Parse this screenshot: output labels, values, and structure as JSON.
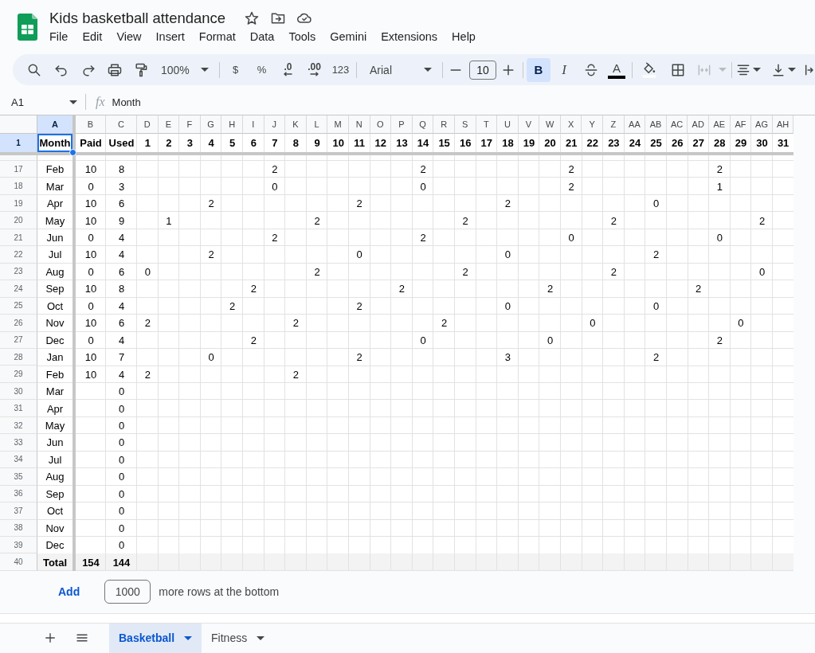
{
  "document": {
    "title": "Kids basketball attendance"
  },
  "menu": [
    "File",
    "Edit",
    "View",
    "Insert",
    "Format",
    "Data",
    "Tools",
    "Gemini",
    "Extensions",
    "Help"
  ],
  "toolbar": {
    "groups": [
      {
        "items": [
          {
            "kind": "search"
          },
          {
            "kind": "undo"
          },
          {
            "kind": "redo"
          },
          {
            "kind": "print"
          },
          {
            "kind": "paint-format"
          },
          {
            "kind": "zoom",
            "label": "100%"
          }
        ]
      },
      {
        "items": [
          {
            "kind": "text",
            "label": "$"
          },
          {
            "kind": "text",
            "label": "%"
          },
          {
            "kind": "decrease-decimal",
            "label": ".0"
          },
          {
            "kind": "increase-decimal",
            "label": ".00"
          },
          {
            "kind": "text",
            "label": "123"
          }
        ]
      },
      {
        "items": [
          {
            "kind": "font",
            "label": "Arial"
          }
        ]
      },
      {
        "items": [
          {
            "kind": "minus"
          },
          {
            "kind": "font-size",
            "value": "10"
          },
          {
            "kind": "plus"
          }
        ]
      },
      {
        "items": [
          {
            "kind": "bold",
            "label": "B",
            "on": true
          },
          {
            "kind": "italic",
            "label": "I",
            "on": false
          },
          {
            "kind": "strikethrough",
            "on": false
          },
          {
            "kind": "text-color",
            "label": "A",
            "on": false
          }
        ]
      },
      {
        "items": [
          {
            "kind": "fill-color",
            "disabled": false
          },
          {
            "kind": "borders",
            "disabled": false
          },
          {
            "kind": "merge",
            "disabled": true
          }
        ]
      },
      {
        "items": [
          {
            "kind": "align"
          },
          {
            "kind": "vertical-align"
          },
          {
            "kind": "wrap"
          }
        ]
      }
    ]
  },
  "formula_bar": {
    "name_box": "A1",
    "function_label": "fx",
    "content": "Month"
  },
  "grid": {
    "columns": [
      {
        "label": "A",
        "selected": true
      },
      {
        "label": "B",
        "selected": false
      },
      {
        "label": "C",
        "selected": false
      },
      {
        "label": "D",
        "selected": false
      },
      {
        "label": "E",
        "selected": false
      },
      {
        "label": "F",
        "selected": false
      },
      {
        "label": "G",
        "selected": false
      },
      {
        "label": "H",
        "selected": false
      },
      {
        "label": "I",
        "selected": false
      },
      {
        "label": "J",
        "selected": false
      },
      {
        "label": "K",
        "selected": false
      },
      {
        "label": "L",
        "selected": false
      },
      {
        "label": "M",
        "selected": false
      },
      {
        "label": "N",
        "selected": false
      },
      {
        "label": "O",
        "selected": false
      },
      {
        "label": "P",
        "selected": false
      },
      {
        "label": "Q",
        "selected": false
      },
      {
        "label": "R",
        "selected": false
      },
      {
        "label": "S",
        "selected": false
      },
      {
        "label": "T",
        "selected": false
      },
      {
        "label": "U",
        "selected": false
      },
      {
        "label": "V",
        "selected": false
      },
      {
        "label": "W",
        "selected": false
      },
      {
        "label": "X",
        "selected": false
      },
      {
        "label": "Y",
        "selected": false
      },
      {
        "label": "Z",
        "selected": false
      },
      {
        "label": "AA",
        "selected": false
      },
      {
        "label": "AB",
        "selected": false
      },
      {
        "label": "AC",
        "selected": false
      },
      {
        "label": "AD",
        "selected": false
      },
      {
        "label": "AE",
        "selected": false
      },
      {
        "label": "AF",
        "selected": false
      },
      {
        "label": "AG",
        "selected": false
      },
      {
        "label": "AH",
        "selected": false
      }
    ],
    "rows": [
      {
        "number": "1",
        "kind": "header",
        "selected": true,
        "cells": [
          "Month",
          "Paid",
          "Used",
          "1",
          "2",
          "3",
          "4",
          "5",
          "6",
          "7",
          "8",
          "9",
          "10",
          "11",
          "12",
          "13",
          "14",
          "15",
          "16",
          "17",
          "18",
          "19",
          "20",
          "21",
          "22",
          "23",
          "24",
          "25",
          "26",
          "27",
          "28",
          "29",
          "30",
          "31"
        ]
      },
      {
        "number": "17",
        "kind": "data",
        "selected": false,
        "cells": [
          "Feb",
          "10",
          "8",
          null,
          null,
          null,
          null,
          null,
          null,
          "2",
          null,
          null,
          null,
          null,
          null,
          null,
          "2",
          null,
          null,
          null,
          null,
          null,
          null,
          "2",
          null,
          null,
          null,
          null,
          null,
          null,
          "2"
        ]
      },
      {
        "number": "18",
        "kind": "data",
        "selected": false,
        "cells": [
          "Mar",
          "0",
          "3",
          null,
          null,
          null,
          null,
          null,
          null,
          "0",
          null,
          null,
          null,
          null,
          null,
          null,
          "0",
          null,
          null,
          null,
          null,
          null,
          null,
          "2",
          null,
          null,
          null,
          null,
          null,
          null,
          "1"
        ]
      },
      {
        "number": "19",
        "kind": "data",
        "selected": false,
        "cells": [
          "Apr",
          "10",
          "6",
          null,
          null,
          null,
          "2",
          null,
          null,
          null,
          null,
          null,
          null,
          "2",
          null,
          null,
          null,
          null,
          null,
          null,
          "2",
          null,
          null,
          null,
          null,
          null,
          null,
          "0"
        ]
      },
      {
        "number": "20",
        "kind": "data",
        "selected": false,
        "cells": [
          "May",
          "10",
          "9",
          null,
          "1",
          null,
          null,
          null,
          null,
          null,
          null,
          "2",
          null,
          null,
          null,
          null,
          null,
          null,
          "2",
          null,
          null,
          null,
          null,
          null,
          null,
          "2",
          null,
          null,
          null,
          null,
          null,
          null,
          "2"
        ]
      },
      {
        "number": "21",
        "kind": "data",
        "selected": false,
        "cells": [
          "Jun",
          "0",
          "4",
          null,
          null,
          null,
          null,
          null,
          null,
          "2",
          null,
          null,
          null,
          null,
          null,
          null,
          "2",
          null,
          null,
          null,
          null,
          null,
          null,
          "0",
          null,
          null,
          null,
          null,
          null,
          null,
          "0"
        ]
      },
      {
        "number": "22",
        "kind": "data",
        "selected": false,
        "cells": [
          "Jul",
          "10",
          "4",
          null,
          null,
          null,
          "2",
          null,
          null,
          null,
          null,
          null,
          null,
          "0",
          null,
          null,
          null,
          null,
          null,
          null,
          "0",
          null,
          null,
          null,
          null,
          null,
          null,
          "2"
        ]
      },
      {
        "number": "23",
        "kind": "data",
        "selected": false,
        "cells": [
          "Aug",
          "0",
          "6",
          "0",
          null,
          null,
          null,
          null,
          null,
          null,
          null,
          "2",
          null,
          null,
          null,
          null,
          null,
          null,
          "2",
          null,
          null,
          null,
          null,
          null,
          null,
          "2",
          null,
          null,
          null,
          null,
          null,
          null,
          "0"
        ]
      },
      {
        "number": "24",
        "kind": "data",
        "selected": false,
        "cells": [
          "Sep",
          "10",
          "8",
          null,
          null,
          null,
          null,
          null,
          "2",
          null,
          null,
          null,
          null,
          null,
          null,
          "2",
          null,
          null,
          null,
          null,
          null,
          null,
          "2",
          null,
          null,
          null,
          null,
          null,
          null,
          "2"
        ]
      },
      {
        "number": "25",
        "kind": "data",
        "selected": false,
        "cells": [
          "Oct",
          "0",
          "4",
          null,
          null,
          null,
          null,
          "2",
          null,
          null,
          null,
          null,
          null,
          "2",
          null,
          null,
          null,
          null,
          null,
          null,
          "0",
          null,
          null,
          null,
          null,
          null,
          null,
          "0"
        ]
      },
      {
        "number": "26",
        "kind": "data",
        "selected": false,
        "cells": [
          "Nov",
          "10",
          "6",
          "2",
          null,
          null,
          null,
          null,
          null,
          null,
          "2",
          null,
          null,
          null,
          null,
          null,
          null,
          "2",
          null,
          null,
          null,
          null,
          null,
          null,
          "0",
          null,
          null,
          null,
          null,
          null,
          null,
          "0"
        ]
      },
      {
        "number": "27",
        "kind": "data",
        "selected": false,
        "cells": [
          "Dec",
          "0",
          "4",
          null,
          null,
          null,
          null,
          null,
          "2",
          null,
          null,
          null,
          null,
          null,
          null,
          null,
          "0",
          null,
          null,
          null,
          null,
          null,
          "0",
          null,
          null,
          null,
          null,
          null,
          null,
          null,
          "2"
        ]
      },
      {
        "number": "28",
        "kind": "data",
        "selected": false,
        "cells": [
          "Jan",
          "10",
          "7",
          null,
          null,
          null,
          "0",
          null,
          null,
          null,
          null,
          null,
          null,
          "2",
          null,
          null,
          null,
          null,
          null,
          null,
          "3",
          null,
          null,
          null,
          null,
          null,
          null,
          "2"
        ]
      },
      {
        "number": "29",
        "kind": "data",
        "selected": false,
        "cells": [
          "Feb",
          "10",
          "4",
          "2",
          null,
          null,
          null,
          null,
          null,
          null,
          "2"
        ]
      },
      {
        "number": "30",
        "kind": "data",
        "selected": false,
        "cells": [
          "Mar",
          null,
          "0"
        ]
      },
      {
        "number": "31",
        "kind": "data",
        "selected": false,
        "cells": [
          "Apr",
          null,
          "0"
        ]
      },
      {
        "number": "32",
        "kind": "data",
        "selected": false,
        "cells": [
          "May",
          null,
          "0"
        ]
      },
      {
        "number": "33",
        "kind": "data",
        "selected": false,
        "cells": [
          "Jun",
          null,
          "0"
        ]
      },
      {
        "number": "34",
        "kind": "data",
        "selected": false,
        "cells": [
          "Jul",
          null,
          "0"
        ]
      },
      {
        "number": "35",
        "kind": "data",
        "selected": false,
        "cells": [
          "Aug",
          null,
          "0"
        ]
      },
      {
        "number": "36",
        "kind": "data",
        "selected": false,
        "cells": [
          "Sep",
          null,
          "0"
        ]
      },
      {
        "number": "37",
        "kind": "data",
        "selected": false,
        "cells": [
          "Oct",
          null,
          "0"
        ]
      },
      {
        "number": "38",
        "kind": "data",
        "selected": false,
        "cells": [
          "Nov",
          null,
          "0"
        ]
      },
      {
        "number": "39",
        "kind": "data",
        "selected": false,
        "cells": [
          "Dec",
          null,
          "0"
        ]
      },
      {
        "number": "40",
        "kind": "total",
        "selected": false,
        "cells": [
          "Total",
          "154",
          "144"
        ]
      }
    ]
  },
  "add_rows": {
    "button": "Add",
    "count": "1000",
    "suffix": "more rows at the bottom"
  },
  "sheets": [
    {
      "name": "Basketball",
      "selected": true
    },
    {
      "name": "Fitness",
      "selected": false
    }
  ]
}
